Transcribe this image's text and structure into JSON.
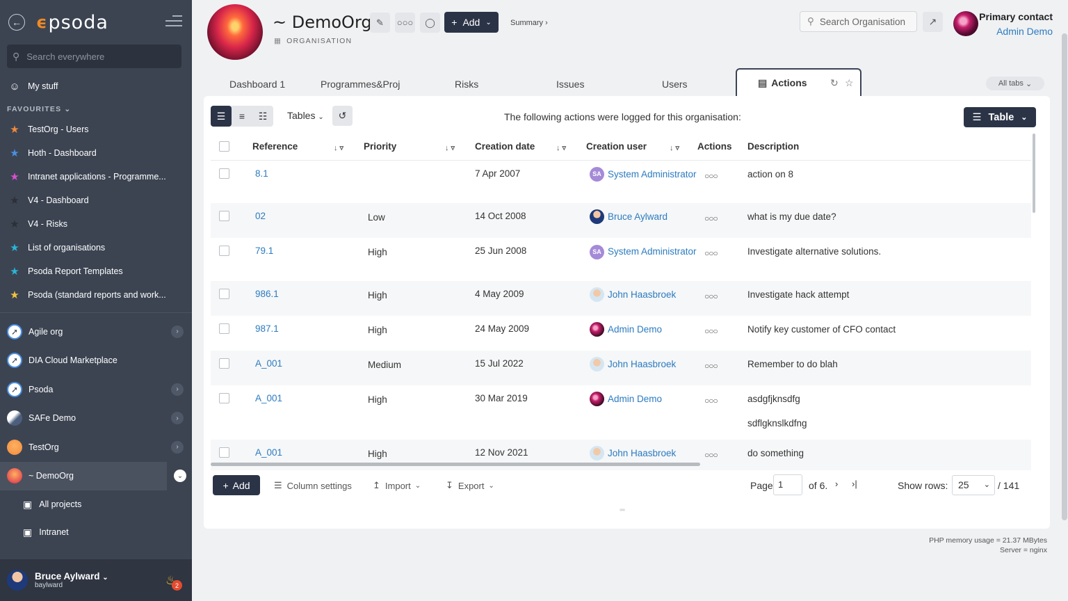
{
  "sidebar": {
    "logo": "psoda",
    "search_placeholder": "Search everywhere",
    "my_stuff": "My stuff",
    "favourites_label": "FAVOURITES",
    "favourites": [
      {
        "label": "TestOrg - Users",
        "color": "#f08a3c"
      },
      {
        "label": "Hoth - Dashboard",
        "color": "#4a90e2"
      },
      {
        "label": "Intranet applications - Programme...",
        "color": "#d94fd0"
      },
      {
        "label": "V4 - Dashboard",
        "color": "#2b2f36"
      },
      {
        "label": "V4 - Risks",
        "color": "#2b2f36"
      },
      {
        "label": "List of organisations",
        "color": "#29b6d6"
      },
      {
        "label": "Psoda Report Templates",
        "color": "#29b6d6"
      },
      {
        "label": "Psoda (standard reports and work...",
        "color": "#f5c23e"
      }
    ],
    "orgs": [
      {
        "label": "Agile org",
        "has_chevron": true
      },
      {
        "label": "DIA Cloud Marketplace",
        "has_chevron": false
      },
      {
        "label": "Psoda",
        "has_chevron": true
      },
      {
        "label": "SAFe Demo",
        "has_chevron": true
      },
      {
        "label": "TestOrg",
        "has_chevron": true
      },
      {
        "label": "~ DemoOrg",
        "has_chevron": true
      }
    ],
    "sub_items": [
      "All projects",
      "Intranet"
    ],
    "user": {
      "name": "Bruce Aylward",
      "login": "baylward",
      "notifications": "2"
    }
  },
  "header": {
    "title": "~ DemoOrg",
    "subtitle": "ORGANISATION",
    "add_label": "Add",
    "summary_label": "Summary ›",
    "search_placeholder": "Search Organisation",
    "primary_contact_label": "Primary contact",
    "primary_contact_name": "Admin Demo"
  },
  "tabs": [
    "Dashboard 1",
    "Programmes&Proj",
    "Risks",
    "Issues",
    "Users"
  ],
  "active_tab": "Actions",
  "all_tabs_label": "All tabs",
  "toolbar": {
    "tables_label": "Tables",
    "message": "The following actions were logged for this organisation:",
    "table_view_label": "Table"
  },
  "columns": [
    "Reference",
    "Priority",
    "Creation date",
    "Creation user",
    "Actions",
    "Description"
  ],
  "rows": [
    {
      "ref": "8.1",
      "priority": "",
      "date": "7 Apr 2007",
      "user": "System Administrator",
      "avatar": "sa",
      "desc": "action on 8"
    },
    {
      "ref": "02",
      "priority": "Low",
      "date": "14 Oct 2008",
      "user": "Bruce Aylward",
      "avatar": "ba",
      "desc": "what is my due date?"
    },
    {
      "ref": "79.1",
      "priority": "High",
      "date": "25 Jun 2008",
      "user": "System Administrator",
      "avatar": "sa",
      "desc": "Investigate alternative solutions."
    },
    {
      "ref": "986.1",
      "priority": "High",
      "date": "4 May 2009",
      "user": "John Haasbroek",
      "avatar": "jh",
      "desc": "Investigate hack attempt"
    },
    {
      "ref": "987.1",
      "priority": "High",
      "date": "24 May 2009",
      "user": "Admin Demo",
      "avatar": "ad",
      "desc": "Notify key customer of CFO contact"
    },
    {
      "ref": "A_001",
      "priority": "Medium",
      "date": "15 Jul 2022",
      "user": "John Haasbroek",
      "avatar": "jh",
      "desc": "Remember to do blah"
    },
    {
      "ref": "A_001",
      "priority": "High",
      "date": "30 Mar 2019",
      "user": "Admin Demo",
      "avatar": "ad",
      "desc": "asdgfjknsdfg",
      "desc2": "sdflgknslkdfng"
    },
    {
      "ref": "A_001",
      "priority": "High",
      "date": "12 Nov 2021",
      "user": "John Haasbroek",
      "avatar": "jh",
      "desc": "do something"
    }
  ],
  "footer": {
    "add_label": "Add",
    "column_settings": "Column settings",
    "import": "Import",
    "export": "Export",
    "page_label": "Page",
    "page_value": "1",
    "of_pages": "of 6.",
    "show_rows_label": "Show rows:",
    "rows_value": "25",
    "total": "/ 141"
  },
  "memory": {
    "line1": "PHP memory usage = 21.37 MBytes",
    "line2": "Server = nginx"
  }
}
